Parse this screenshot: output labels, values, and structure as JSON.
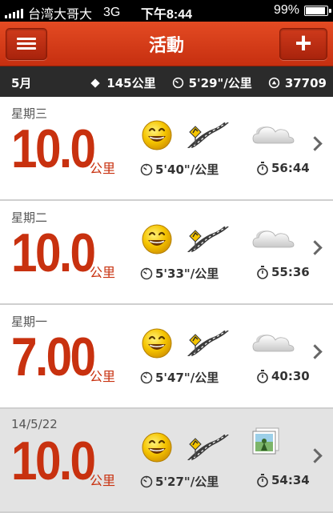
{
  "status": {
    "carrier": "台湾大哥大",
    "network": "3G",
    "time": "下午8:44",
    "battery": "99%",
    "battery_level": 0.99
  },
  "nav": {
    "title": "活動"
  },
  "summary": {
    "month": "5月",
    "distance": "145公里",
    "pace": "5'29\"/公里",
    "calories": "37709"
  },
  "runs": [
    {
      "day": "星期三",
      "distance": "10.0",
      "unit": "公里",
      "pace": "5'40\"/公里",
      "time": "56:44",
      "mood_icon": "smiley-icon",
      "terrain_icon": "road-icon",
      "extra_icon": "cloud-icon"
    },
    {
      "day": "星期二",
      "distance": "10.0",
      "unit": "公里",
      "pace": "5'33\"/公里",
      "time": "55:36",
      "mood_icon": "smiley-icon",
      "terrain_icon": "road-icon",
      "extra_icon": "cloud-icon"
    },
    {
      "day": "星期一",
      "distance": "7.00",
      "unit": "公里",
      "pace": "5'47\"/公里",
      "time": "40:30",
      "mood_icon": "smiley-icon",
      "terrain_icon": "road-icon",
      "extra_icon": "cloud-icon"
    },
    {
      "day": "14/5/22",
      "distance": "10.0",
      "unit": "公里",
      "pace": "5'27\"/公里",
      "time": "54:34",
      "mood_icon": "smiley-icon",
      "terrain_icon": "road-icon",
      "extra_icon": "photo-icon"
    }
  ],
  "colors": {
    "accent": "#c8310f",
    "nav": "#d33c1a",
    "summary_bg": "#2b2b2b"
  }
}
